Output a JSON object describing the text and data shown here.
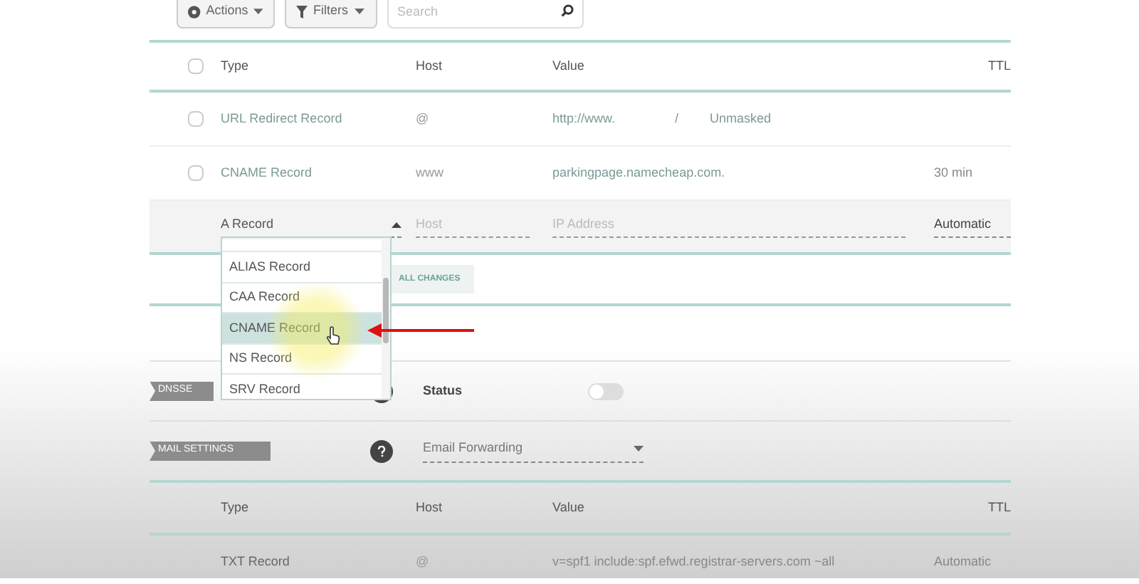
{
  "toolbar": {
    "actions": "Actions",
    "filters": "Filters",
    "search": {
      "placeholder": "Search"
    }
  },
  "records_table": {
    "select_all_checked": false,
    "columns": [
      "Type",
      "Host",
      "Value",
      "TTL"
    ],
    "rows": [
      {
        "checked": false,
        "type": "URL Redirect Record",
        "host": "@",
        "value": "http://www.",
        "value_end": "/",
        "mode": "Unmasked"
      },
      {
        "checked": false,
        "type": "CNAME Record",
        "host": "www",
        "value": "parkingpage.namecheap.com.",
        "ttl": "30 min"
      }
    ]
  },
  "new_record": {
    "type": "A Record",
    "host_placeholder": "Host",
    "value_placeholder": "IP Address",
    "ttl": "Automatic"
  },
  "save_button": "ALL CHANGES",
  "type_dropdown": {
    "items": [
      {
        "label": "ALIAS Record",
        "selected": false
      },
      {
        "label": "CAA Record",
        "selected": false
      },
      {
        "label": "CNAME Record",
        "selected": true
      },
      {
        "label": "NS Record",
        "selected": false
      },
      {
        "label": "SRV Record",
        "selected": false
      }
    ]
  },
  "dnssec": {
    "tag": "DNSSE",
    "status_label": "Status",
    "on": false
  },
  "mail_settings": {
    "tag": "MAIL SETTINGS",
    "value": "Email Forwarding"
  },
  "mail_table": {
    "columns": [
      "Type",
      "Host",
      "Value",
      "TTL"
    ],
    "rows": [
      {
        "type": "TXT Record",
        "host": "@",
        "value": "v=spf1 include:spf.efwd.registrar-servers.com ~all",
        "ttl": "Automatic"
      }
    ]
  }
}
